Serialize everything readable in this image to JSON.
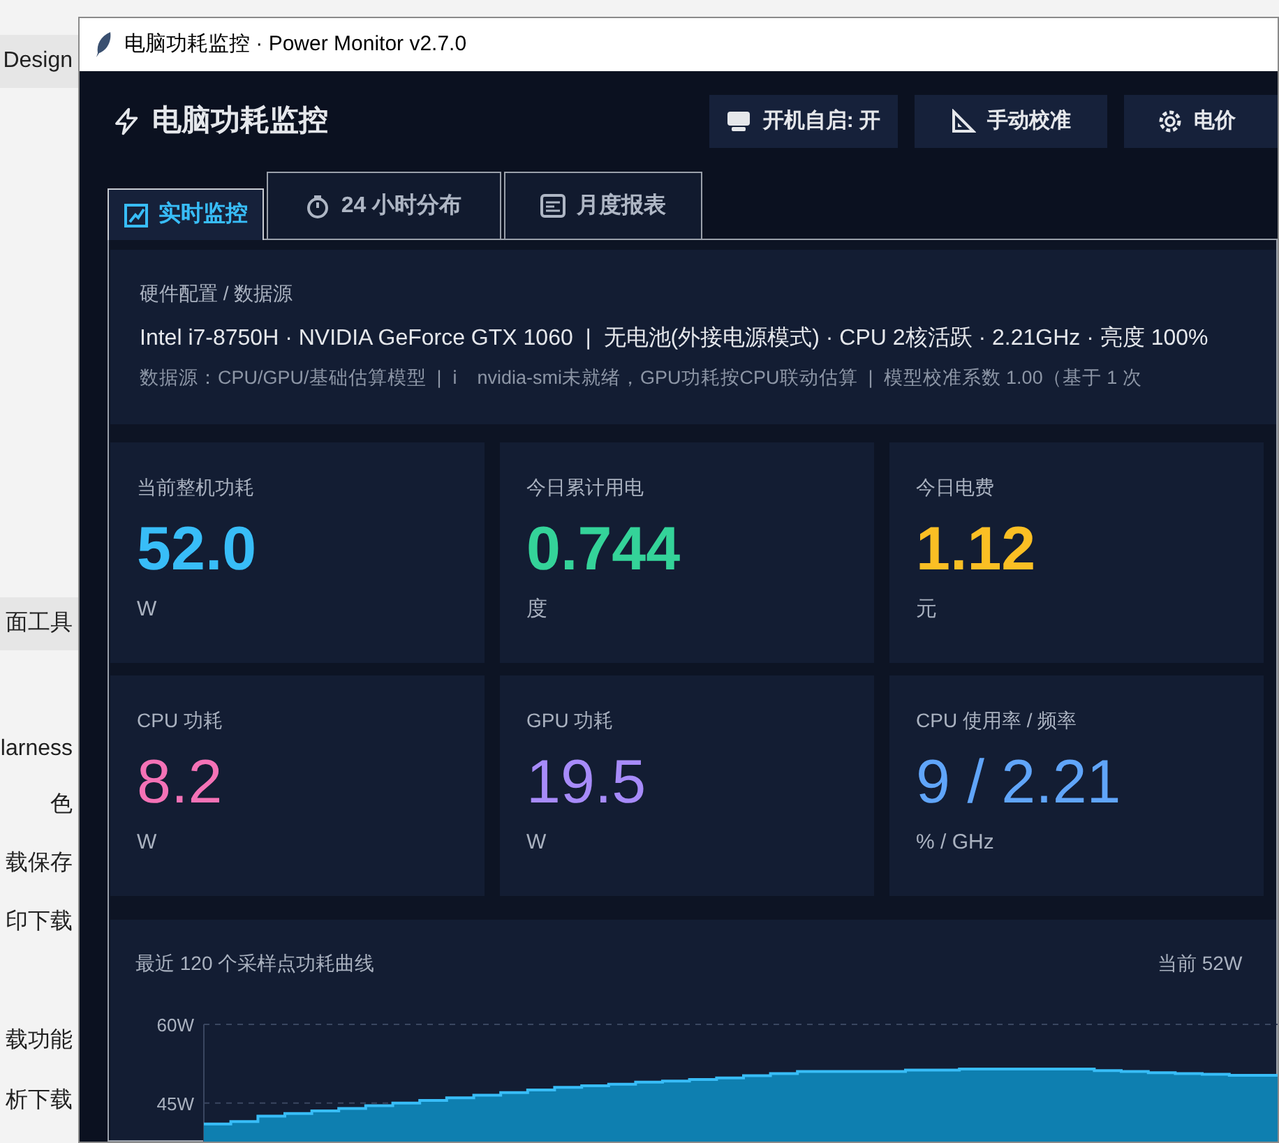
{
  "background_app": {
    "items": [
      {
        "label": "Design",
        "highlighted": true
      },
      {
        "label": "面工具",
        "highlighted": true
      },
      {
        "label": "larness",
        "highlighted": false
      },
      {
        "label": "色",
        "highlighted": false
      },
      {
        "label": "载保存",
        "highlighted": false
      },
      {
        "label": "印下载",
        "highlighted": false
      },
      {
        "label": "载功能",
        "highlighted": false
      },
      {
        "label": "析下载",
        "highlighted": false
      }
    ]
  },
  "window": {
    "title": "电脑功耗监控 · Power Monitor v2.7.0"
  },
  "header": {
    "title": "电脑功耗监控",
    "buttons": [
      {
        "kind": "monitor",
        "label": "开机自启: 开"
      },
      {
        "kind": "ruler",
        "label": "手动校准"
      },
      {
        "kind": "gear",
        "label": "电价"
      }
    ]
  },
  "tabs": [
    {
      "kind": "chart",
      "label": "实时监控",
      "selected": true
    },
    {
      "kind": "timer",
      "label": "24 小时分布",
      "selected": false
    },
    {
      "kind": "report",
      "label": "月度报表",
      "selected": false
    }
  ],
  "hardware": {
    "heading": "硬件配置 / 数据源",
    "summary": "Intel i7-8750H · NVIDIA GeForce GTX 1060  |  无电池(外接电源模式) · CPU 2核活跃 · 2.21GHz · 亮度 100%",
    "source": "数据源：CPU/GPU/基础估算模型  |  ℹ    nvidia-smi未就绪，GPU功耗按CPU联动估算  |  模型校准系数 1.00（基于 1 次"
  },
  "primary_stats": [
    {
      "label": "当前整机功耗",
      "value": "52.0",
      "unit": "W",
      "color": "#38bdf8"
    },
    {
      "label": "今日累计用电",
      "value": "0.744",
      "unit": "度",
      "color": "#34d399"
    },
    {
      "label": "今日电费",
      "value": "1.12",
      "unit": "元",
      "color": "#fbbf24"
    }
  ],
  "secondary_stats": [
    {
      "label": "CPU 功耗",
      "value": "8.2",
      "unit": "W",
      "color": "#f472b6"
    },
    {
      "label": "GPU 功耗",
      "value": "19.5",
      "unit": "W",
      "color": "#a78bfa"
    },
    {
      "label": "CPU 使用率 / 频率",
      "value": "9 / 2.21",
      "unit": "% / GHz",
      "color": "#60a5fa"
    }
  ],
  "power_chart": {
    "title": "最近 120 个采样点功耗曲线",
    "current": "当前 52W",
    "chart_data": {
      "type": "area",
      "ylim": [
        35,
        60
      ],
      "yticks": [
        {
          "value": 60,
          "label": "60W"
        },
        {
          "value": 45,
          "label": "45W"
        }
      ],
      "series": [
        {
          "color": "#38bdf8",
          "values": [
            41,
            41.5,
            42.5,
            43,
            43.5,
            44,
            44.5,
            45,
            45.5,
            46,
            46.5,
            47,
            47.5,
            48,
            48.3,
            48.6,
            49,
            49.2,
            49.5,
            49.8,
            50.2,
            50.6,
            51,
            51,
            51,
            51,
            51.3,
            51.3,
            51.5,
            51.5,
            51.5,
            51.5,
            51.5,
            51.2,
            51,
            50.8,
            50.6,
            50.5,
            50.3,
            50.3
          ]
        }
      ]
    }
  }
}
